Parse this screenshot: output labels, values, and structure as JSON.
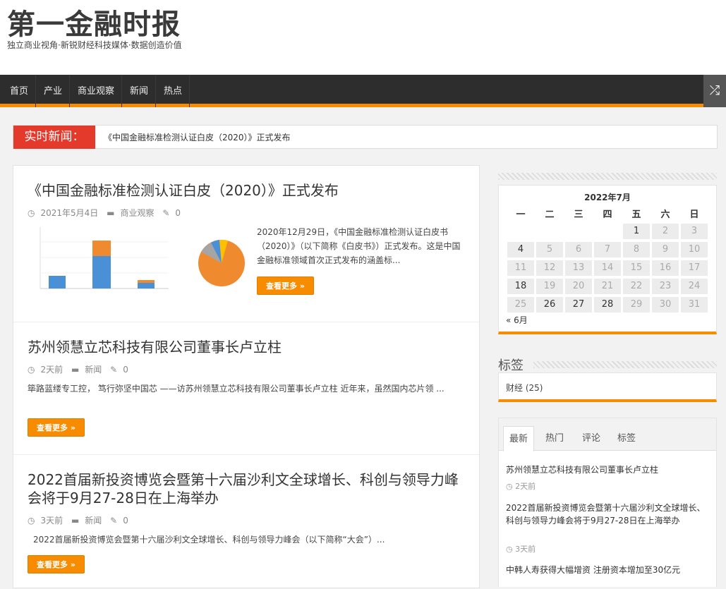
{
  "site": {
    "title": "第一金融时报",
    "tagline": "独立商业视角·新锐财经科技媒体·数据创造价值"
  },
  "nav": {
    "items": [
      "首页",
      "产业",
      "商业观察",
      "新闻",
      "热点"
    ],
    "random_icon": "shuffle-icon"
  },
  "ticker": {
    "label": "实时新闻：",
    "text": "《中国金融标准检测认证白皮（2020）》正式发布"
  },
  "posts": [
    {
      "title": "《中国金融标准检测认证白皮（2020）》正式发布",
      "date": "2021年5月4日",
      "category": "商业观察",
      "comments": "0",
      "excerpt": "2020年12月29日，《中国金融标准检测认证白皮书（2020）》（以下简称《白皮书》）正式发布。这是中国金融标准领域首次正式发布的涵盖标...",
      "more": "查看更多 »"
    },
    {
      "title": "苏州领慧立芯科技有限公司董事长卢立柱",
      "date": "2天前",
      "category": "新闻",
      "comments": "0",
      "excerpt": "筚路蓝缕专工控， 笃行弥坚中国芯 ——访苏州领慧立芯科技有限公司董事长卢立柱 近年来，虽然国内芯片领 ...",
      "more": "查看更多 »"
    },
    {
      "title": "2022首届新投资博览会暨第十六届沙利文全球增长、科创与领导力峰会将于9月27-28日在上海举办",
      "date": "3天前",
      "category": "新闻",
      "comments": "0",
      "excerpt": "2022首届新投资博览会暨第十六届沙利文全球增长、科创与领导力峰会（以下简称“大会”）...",
      "more": "查看更多 »"
    }
  ],
  "calendar": {
    "caption": "2022年7月",
    "weekdays": [
      "一",
      "二",
      "三",
      "四",
      "五",
      "六",
      "日"
    ],
    "days": [
      "1",
      "2",
      "3",
      "4",
      "5",
      "6",
      "7",
      "8",
      "9",
      "10",
      "11",
      "12",
      "13",
      "14",
      "15",
      "16",
      "17",
      "18",
      "19",
      "20",
      "21",
      "22",
      "23",
      "24",
      "25",
      "26",
      "27",
      "28",
      "29",
      "30",
      "31"
    ],
    "active_days": [
      "1",
      "4",
      "18",
      "26",
      "27",
      "28"
    ],
    "prev": "« 6月"
  },
  "tags": {
    "title": "标签",
    "items": [
      "财经 (25)"
    ]
  },
  "tabs": {
    "items": [
      "最新",
      "热门",
      "评论",
      "标签"
    ],
    "active": "最新",
    "recent": [
      {
        "title": "苏州领慧立芯科技有限公司董事长卢立柱",
        "time": "2天前"
      },
      {
        "title": "2022首届新投资博览会暨第十六届沙利文全球增长、科创与领导力峰会将于9月27-28日在上海举办",
        "time": "3天前"
      },
      {
        "title": "中韩人寿获得大幅增资 注册资本增加至30亿元",
        "time": ""
      }
    ]
  },
  "colors": {
    "accent": "#f88c00",
    "ticker": "#e33a2c",
    "nav": "#2d2d2d"
  }
}
